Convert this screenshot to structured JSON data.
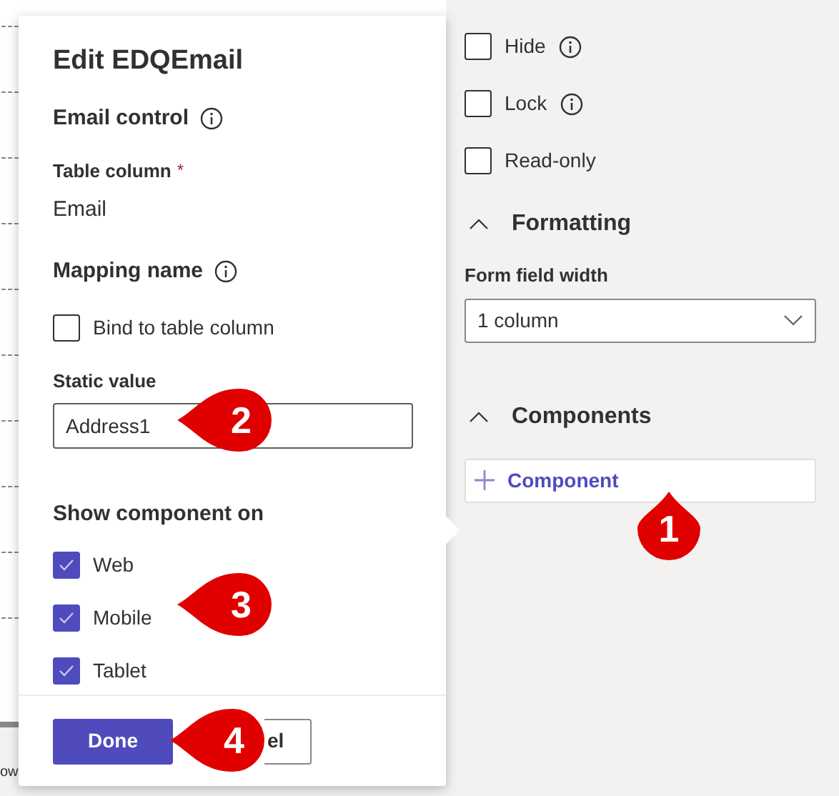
{
  "background": {
    "footer_text": "ow"
  },
  "dialog": {
    "title": "Edit EDQEmail",
    "control_heading": "Email control",
    "table_column": {
      "label": "Table column",
      "required_mark": "*",
      "value": "Email"
    },
    "mapping_heading": "Mapping name",
    "bind_checkbox": {
      "label": "Bind to table column",
      "checked": false
    },
    "static_value": {
      "label": "Static value",
      "value": "Address1"
    },
    "show_heading": "Show component on",
    "show_options": [
      {
        "label": "Web",
        "checked": true
      },
      {
        "label": "Mobile",
        "checked": true
      },
      {
        "label": "Tablet",
        "checked": true
      }
    ],
    "buttons": [
      {
        "kind": "primary",
        "label": "Done"
      },
      {
        "kind": "secondary",
        "label": "el"
      }
    ]
  },
  "properties": {
    "checkboxes": [
      {
        "label": "Hide",
        "checked": false,
        "info": true
      },
      {
        "label": "Lock",
        "checked": false,
        "info": true
      },
      {
        "label": "Read-only",
        "checked": false,
        "info": false
      }
    ],
    "formatting": {
      "title": "Formatting",
      "expanded": true,
      "width_label": "Form field width",
      "width_value": "1 column"
    },
    "components": {
      "title": "Components",
      "expanded": true,
      "add_button": "Component"
    }
  },
  "callouts": [
    {
      "label": "1",
      "kind": "up"
    },
    {
      "label": "2",
      "kind": "left"
    },
    {
      "label": "3",
      "kind": "left"
    },
    {
      "label": "4",
      "kind": "left"
    }
  ]
}
